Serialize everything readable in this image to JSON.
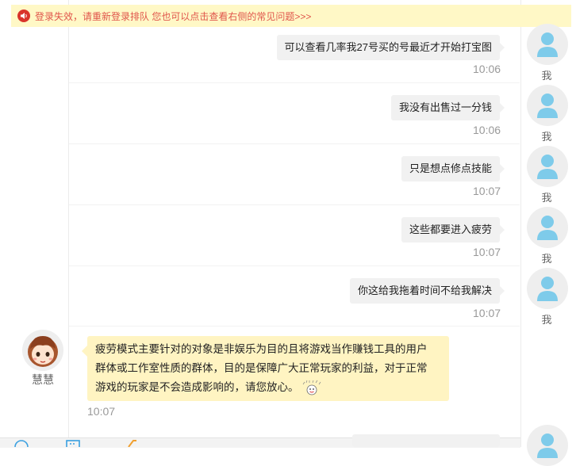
{
  "notice": {
    "text": "登录失效，请重新登录排队 您也可以点击查看右侧的常见问题>>>",
    "icon": "speaker-icon",
    "color": "#e0554b"
  },
  "messages": [
    {
      "text": "可以查看几率我27号买的号最近才开始打宝图",
      "time": "10:06",
      "sender": "我"
    },
    {
      "text": "我没有出售过一分钱",
      "time": "10:06",
      "sender": "我"
    },
    {
      "text": "只是想点修点技能",
      "time": "10:07",
      "sender": "我"
    },
    {
      "text": "这些都要进入疲劳",
      "time": "10:07",
      "sender": "我"
    },
    {
      "text": "你这给我拖着时间不给我解决",
      "time": "10:07",
      "sender": "我"
    }
  ],
  "agent": {
    "name": "慧慧",
    "line1": "疲劳模式主要针对的对象是非娱乐为目的且将游戏当作赚钱工具的用户",
    "line2": "群体或工作室性质的群体，目的是保障广大正常玩家的利益，对于正常",
    "line3": "游戏的玩家是不会造成影响的，请您放心。",
    "time": "10:07"
  },
  "colors": {
    "notice_bg": "#fff8c6",
    "agent_bubble": "#fff4c2",
    "user_bubble": "#f1f1f1",
    "avatar_blue": "#7ecbea"
  }
}
